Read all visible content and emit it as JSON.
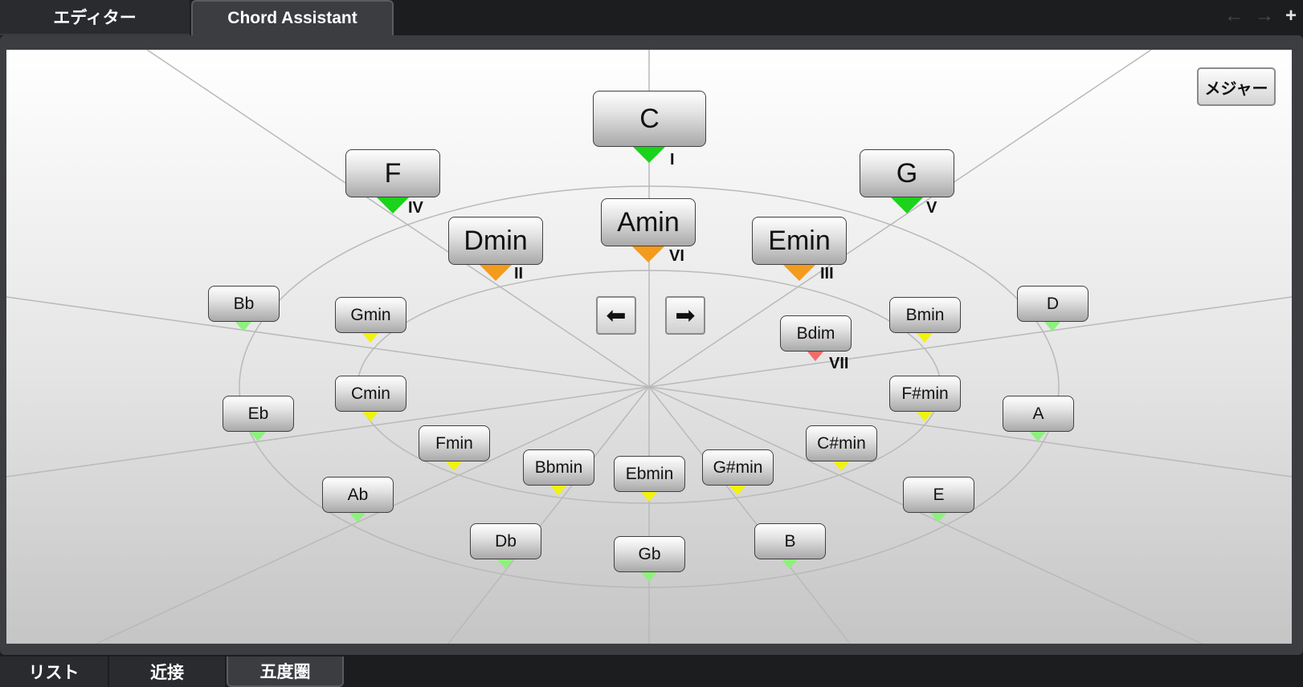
{
  "top_tabs": [
    {
      "label": "エディター",
      "active": false
    },
    {
      "label": "Chord Assistant",
      "active": true
    }
  ],
  "nav": {
    "back_icon": "←",
    "forward_icon": "→",
    "add_icon": "+"
  },
  "mode_button_label": "メジャー",
  "arrows": {
    "left": "⬅",
    "right": "➡"
  },
  "chords": {
    "c": "C",
    "f": "F",
    "g": "G",
    "amin": "Amin",
    "dmin": "Dmin",
    "emin": "Emin",
    "bdim": "Bdim",
    "bb": "Bb",
    "gmin": "Gmin",
    "bmin": "Bmin",
    "d": "D",
    "eb": "Eb",
    "cmin": "Cmin",
    "fsmin": "F#min",
    "a": "A",
    "fmin": "Fmin",
    "csmin": "C#min",
    "bbmin": "Bbmin",
    "ebmin": "Ebmin",
    "gsmin": "G#min",
    "ab": "Ab",
    "e": "E",
    "db": "Db",
    "gb": "Gb",
    "b": "B"
  },
  "degrees": {
    "i": "I",
    "ii": "II",
    "iii": "III",
    "iv": "IV",
    "v": "V",
    "vi": "VI",
    "vii": "VII"
  },
  "indicator_colors": {
    "primary": "#1ad31a",
    "relative": "#f39b1c",
    "minor": "#f2f20f",
    "major": "#8ef07e",
    "diminished": "#f26b6b"
  },
  "bottom_tabs": [
    {
      "label": "リスト",
      "active": false
    },
    {
      "label": "近接",
      "active": false
    },
    {
      "label": "五度圏",
      "active": true
    }
  ]
}
